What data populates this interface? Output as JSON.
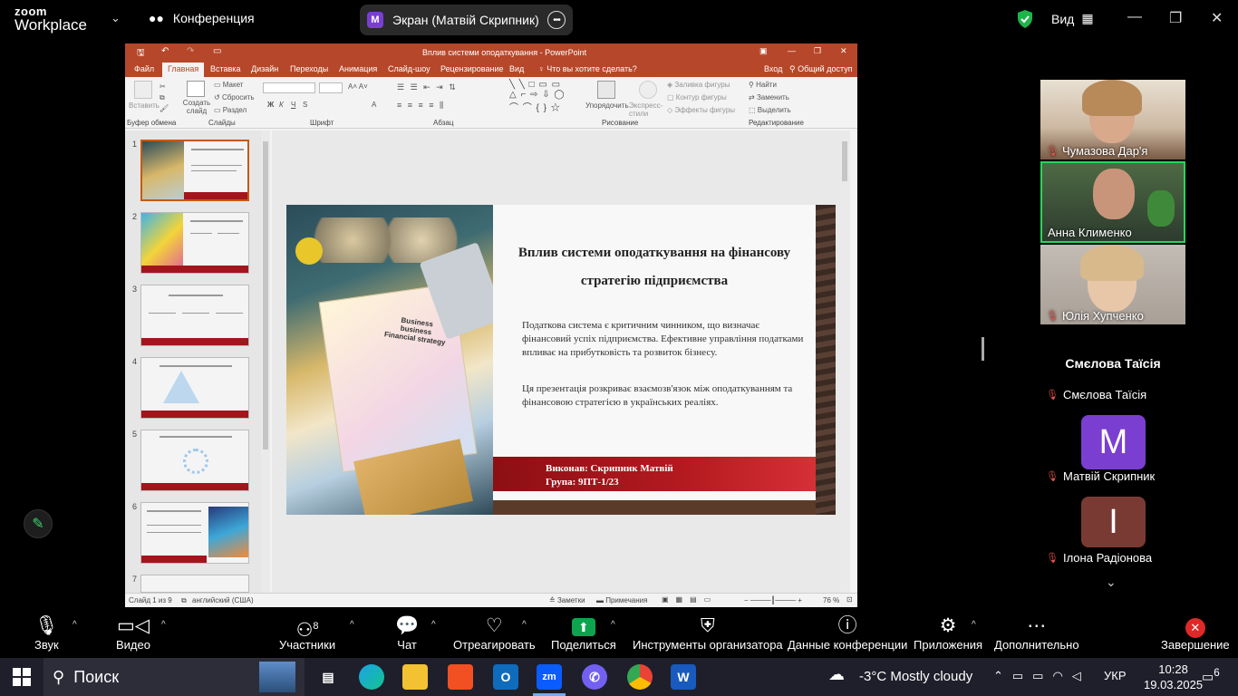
{
  "zoom": {
    "logo_line1": "zoom",
    "logo_line2": "Workplace",
    "meeting_label": "Конференция",
    "share_badge": "M",
    "share_label": "Экран (Матвій Скрипник)",
    "view_label": "Вид"
  },
  "ppt": {
    "window_title": "Вплив системи оподаткування - PowerPoint",
    "tabs": [
      "Файл",
      "Главная",
      "Вставка",
      "Дизайн",
      "Переходы",
      "Анимация",
      "Слайд-шоу",
      "Рецензирование",
      "Вид"
    ],
    "tell_me": "Что вы хотите сделать?",
    "login": "Вход",
    "share": "Общий доступ",
    "ribbon": {
      "paste": "Вставить",
      "create_slide": "Создать слайд",
      "layout": "Макет",
      "reset": "Сбросить",
      "section": "Раздел",
      "arrange": "Упорядочить",
      "express": "Экспресс-стили",
      "fill": "Заливка фигуры",
      "outline": "Контур фигуры",
      "effects": "Эффекты фигуры",
      "find": "Найти",
      "replace": "Заменить",
      "select": "Выделить",
      "groups": [
        "Буфер обмена",
        "Слайды",
        "Шрифт",
        "Абзац",
        "Рисование",
        "Редактирование"
      ]
    },
    "thumb_numbers": [
      "1",
      "2",
      "3",
      "4",
      "5",
      "6",
      "7"
    ],
    "slide": {
      "title": "Вплив системи оподаткування на фінансову стратегію підприємства",
      "paragraph1": "Податкова система є критичним чинником, що визначає фінансовий успіх підприємства. Ефективне управління податками впливає на прибутковість та розвиток бізнесу.",
      "paragraph2": "Ця презентація розкриває взаємозв'язок між оподаткуванням та фінансовою стратегією в українських реаліях.",
      "author": "Виконав: Скрипник Матвій",
      "group": "Група: 9ПТ-1/23",
      "photo_caption": "Business business Financial strategy"
    },
    "status": {
      "slide_count": "Слайд 1 из 9",
      "language": "английский (США)",
      "notes": "Заметки",
      "comments": "Примечания",
      "zoom": "76 %"
    }
  },
  "participants": {
    "video": [
      {
        "name": "Чумазова Дар'я"
      },
      {
        "name": "Анна Клименко"
      },
      {
        "name": "Юлія Хупченко"
      }
    ],
    "featured_name": "Смєлова Таїсія",
    "list": [
      {
        "name": "Смєлова Таїсія",
        "initial": ""
      },
      {
        "name": "Матвій Скрипник",
        "initial": "M"
      },
      {
        "name": "Ілона Радіонова",
        "initial": "I"
      }
    ]
  },
  "toolbar": {
    "audio": "Звук",
    "video": "Видео",
    "participants": "Участники",
    "participants_count": "8",
    "chat": "Чат",
    "react": "Отреагировать",
    "share": "Поделиться",
    "host_tools": "Инструменты организатора",
    "meeting_info": "Данные конференции",
    "apps": "Приложения",
    "more": "Дополнительно",
    "end": "Завершение"
  },
  "taskbar": {
    "search": "Поиск",
    "weather": "-3°C  Mostly cloudy",
    "lang": "УКР",
    "time": "10:28",
    "date": "19.03.2025",
    "notif": "6"
  },
  "colors": {
    "ppt_accent": "#b7472a",
    "zoom_share_green": "#0ea44f",
    "end_red": "#e02828"
  }
}
